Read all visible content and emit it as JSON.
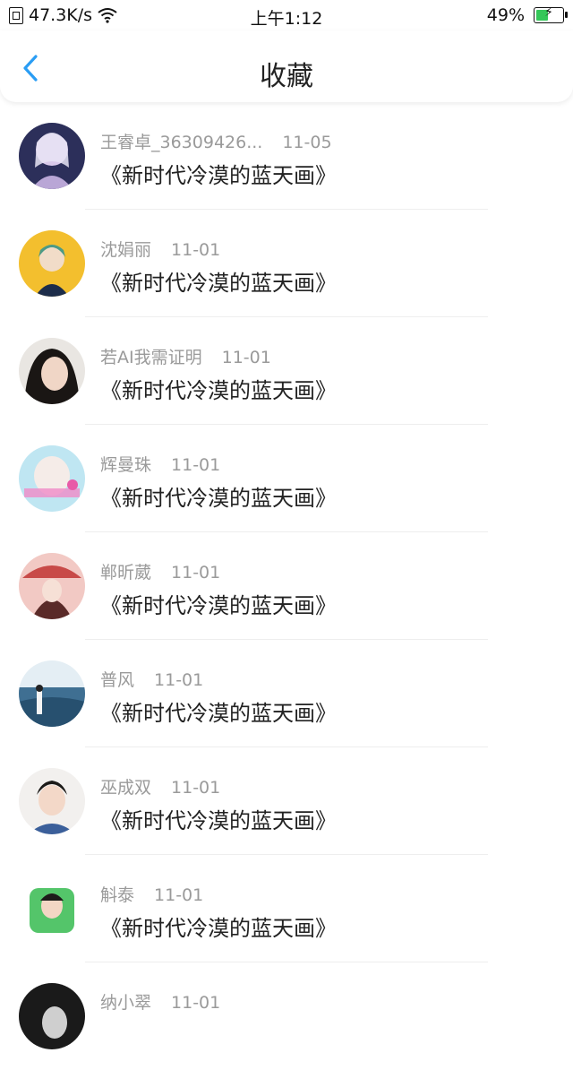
{
  "status_bar": {
    "speed": "47.3K/s",
    "time": "上午1:12",
    "battery": "49%",
    "battery_level": 0.49
  },
  "navbar": {
    "title": "收藏",
    "back_icon": "chevron-left-icon"
  },
  "colors": {
    "accent": "#2a9df4",
    "meta_text": "#9a9a9a",
    "title_text": "#222222",
    "divider": "#eeeeee"
  },
  "items": [
    {
      "name": "王睿卓_36309426...",
      "date": "11-05",
      "title": "《新时代冷漠的蓝天画》"
    },
    {
      "name": "沈娟丽",
      "date": "11-01",
      "title": "《新时代冷漠的蓝天画》"
    },
    {
      "name": "若AI我需证明",
      "date": "11-01",
      "title": "《新时代冷漠的蓝天画》"
    },
    {
      "name": "辉曼珠",
      "date": "11-01",
      "title": "《新时代冷漠的蓝天画》"
    },
    {
      "name": "郸昕葳",
      "date": "11-01",
      "title": "《新时代冷漠的蓝天画》"
    },
    {
      "name": "普风",
      "date": "11-01",
      "title": "《新时代冷漠的蓝天画》"
    },
    {
      "name": "巫成双",
      "date": "11-01",
      "title": "《新时代冷漠的蓝天画》"
    },
    {
      "name": "斛泰",
      "date": "11-01",
      "title": "《新时代冷漠的蓝天画》"
    },
    {
      "name": "纳小翠",
      "date": "11-01",
      "title": ""
    }
  ]
}
